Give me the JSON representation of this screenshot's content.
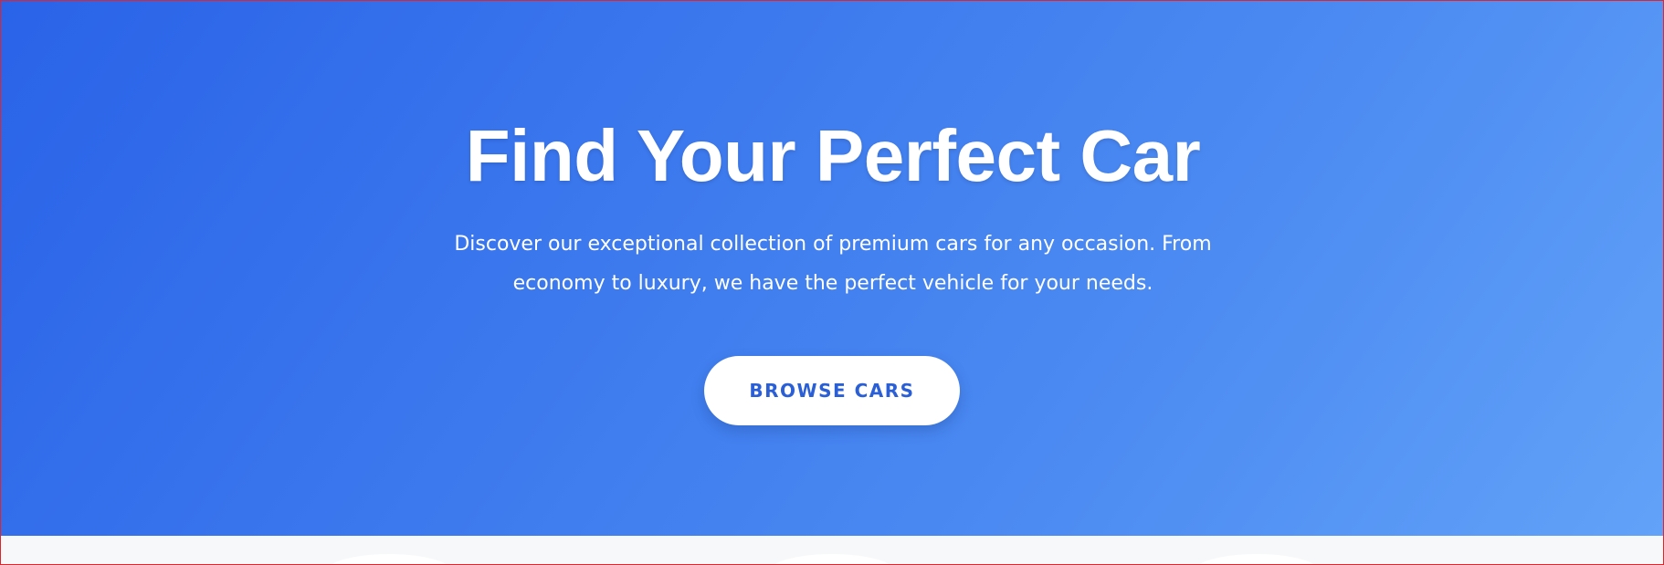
{
  "hero": {
    "title": "Find Your Perfect Car",
    "subtitle": "Discover our exceptional collection of premium cars for any occasion. From economy to luxury, we have the perfect vehicle for your needs.",
    "cta_label": "BROWSE CARS"
  },
  "colors": {
    "gradient_start": "#2a63e8",
    "gradient_end": "#62a2f8",
    "button_text": "#2a5fd6",
    "page_background": "#f7f8fa"
  }
}
